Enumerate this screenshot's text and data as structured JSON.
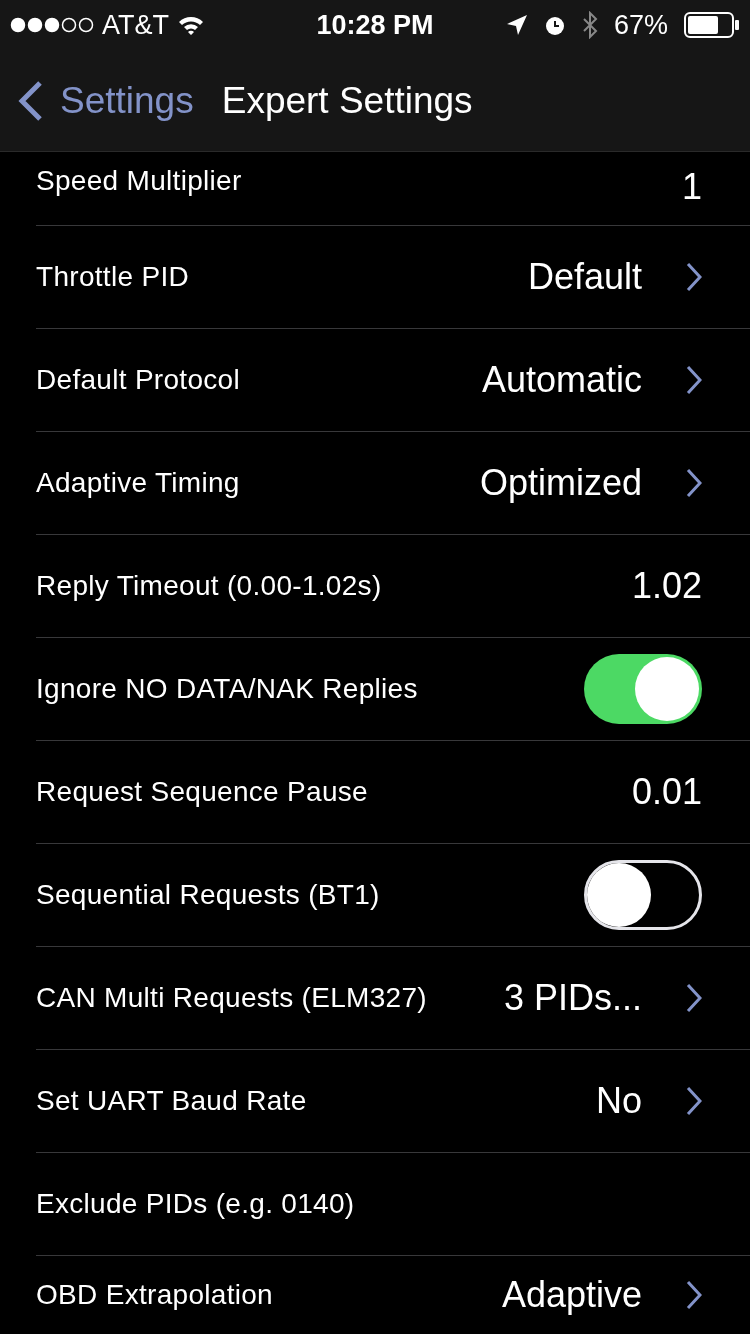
{
  "status_bar": {
    "carrier": "AT&T",
    "time": "10:28 PM",
    "battery": "67%"
  },
  "nav": {
    "back": "Settings",
    "title": "Expert Settings"
  },
  "rows": [
    {
      "kind": "value",
      "label": "Speed Multiplier",
      "value": "1"
    },
    {
      "kind": "disclosure",
      "label": "Throttle PID",
      "value": "Default"
    },
    {
      "kind": "disclosure",
      "label": "Default Protocol",
      "value": "Automatic"
    },
    {
      "kind": "disclosure",
      "label": "Adaptive Timing",
      "value": "Optimized"
    },
    {
      "kind": "value",
      "label": "Reply Timeout (0.00-1.02s)",
      "value": "1.02"
    },
    {
      "kind": "toggle",
      "label": "Ignore NO DATA/NAK Replies",
      "on": true
    },
    {
      "kind": "value",
      "label": "Request Sequence Pause",
      "value": "0.01"
    },
    {
      "kind": "toggle",
      "label": "Sequential Requests (BT1)",
      "on": false
    },
    {
      "kind": "disclosure",
      "label": "CAN Multi Requests (ELM327)",
      "value": "3 PIDs..."
    },
    {
      "kind": "disclosure",
      "label": "Set UART Baud Rate",
      "value": "No"
    },
    {
      "kind": "plain",
      "label": "Exclude PIDs (e.g. 0140)"
    },
    {
      "kind": "disclosure",
      "label": "OBD Extrapolation",
      "value": "Adaptive"
    }
  ]
}
